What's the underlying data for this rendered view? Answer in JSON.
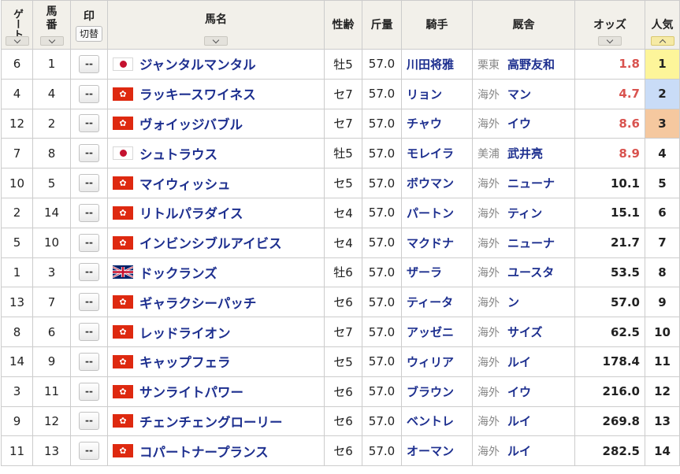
{
  "header": {
    "gate": "ゲート",
    "umaban": "馬番",
    "mark": "印",
    "mark_toggle": "切替",
    "name": "馬名",
    "sex_age": "性齢",
    "weight": "斤量",
    "jockey": "騎手",
    "trainer": "厩舎",
    "odds": "オッズ",
    "popularity": "人気"
  },
  "mark_placeholder": "--",
  "colors": {
    "horse_link": "#1d2f8f",
    "hot_odds": "#d9534f",
    "pop1": "#fdf59a",
    "pop2": "#c9dcf7",
    "pop3": "#f5c89f"
  },
  "rows": [
    {
      "gate": "6",
      "umaban": "1",
      "flag": "jp",
      "name": "ジャンタルマンタル",
      "sex_age": "牡5",
      "weight": "57.0",
      "jockey": "川田将雅",
      "area": "栗東",
      "trainer": "高野友和",
      "odds": "1.8",
      "pop": "1"
    },
    {
      "gate": "4",
      "umaban": "4",
      "flag": "hk",
      "name": "ラッキースワイネス",
      "sex_age": "セ7",
      "weight": "57.0",
      "jockey": "リョン",
      "area": "海外",
      "trainer": "マン",
      "odds": "4.7",
      "pop": "2"
    },
    {
      "gate": "12",
      "umaban": "2",
      "flag": "hk",
      "name": "ヴォイッジバブル",
      "sex_age": "セ7",
      "weight": "57.0",
      "jockey": "チャウ",
      "area": "海外",
      "trainer": "イウ",
      "odds": "8.6",
      "pop": "3"
    },
    {
      "gate": "7",
      "umaban": "8",
      "flag": "jp",
      "name": "シュトラウス",
      "sex_age": "牡5",
      "weight": "57.0",
      "jockey": "モレイラ",
      "area": "美浦",
      "trainer": "武井亮",
      "odds": "8.9",
      "pop": "4"
    },
    {
      "gate": "10",
      "umaban": "5",
      "flag": "hk",
      "name": "マイウィッシュ",
      "sex_age": "セ5",
      "weight": "57.0",
      "jockey": "ボウマン",
      "area": "海外",
      "trainer": "ニューナ",
      "odds": "10.1",
      "pop": "5"
    },
    {
      "gate": "2",
      "umaban": "14",
      "flag": "hk",
      "name": "リトルパラダイス",
      "sex_age": "セ4",
      "weight": "57.0",
      "jockey": "パートン",
      "area": "海外",
      "trainer": "ティン",
      "odds": "15.1",
      "pop": "6"
    },
    {
      "gate": "5",
      "umaban": "10",
      "flag": "hk",
      "name": "インビンシブルアイビス",
      "sex_age": "セ4",
      "weight": "57.0",
      "jockey": "マクドナ",
      "area": "海外",
      "trainer": "ニューナ",
      "odds": "21.7",
      "pop": "7"
    },
    {
      "gate": "1",
      "umaban": "3",
      "flag": "gb",
      "name": "ドックランズ",
      "sex_age": "牡6",
      "weight": "57.0",
      "jockey": "ザーラ",
      "area": "海外",
      "trainer": "ユースタ",
      "odds": "53.5",
      "pop": "8"
    },
    {
      "gate": "13",
      "umaban": "7",
      "flag": "hk",
      "name": "ギャラクシーパッチ",
      "sex_age": "セ6",
      "weight": "57.0",
      "jockey": "ティータ",
      "area": "海外",
      "trainer": "ン",
      "odds": "57.0",
      "pop": "9"
    },
    {
      "gate": "8",
      "umaban": "6",
      "flag": "hk",
      "name": "レッドライオン",
      "sex_age": "セ7",
      "weight": "57.0",
      "jockey": "アッゼニ",
      "area": "海外",
      "trainer": "サイズ",
      "odds": "62.5",
      "pop": "10"
    },
    {
      "gate": "14",
      "umaban": "9",
      "flag": "hk",
      "name": "キャップフェラ",
      "sex_age": "セ5",
      "weight": "57.0",
      "jockey": "ウィリア",
      "area": "海外",
      "trainer": "ルイ",
      "odds": "178.4",
      "pop": "11"
    },
    {
      "gate": "3",
      "umaban": "11",
      "flag": "hk",
      "name": "サンライトパワー",
      "sex_age": "セ6",
      "weight": "57.0",
      "jockey": "ブラウン",
      "area": "海外",
      "trainer": "イウ",
      "odds": "216.0",
      "pop": "12"
    },
    {
      "gate": "9",
      "umaban": "12",
      "flag": "hk",
      "name": "チェンチェングローリー",
      "sex_age": "セ6",
      "weight": "57.0",
      "jockey": "ベントレ",
      "area": "海外",
      "trainer": "ルイ",
      "odds": "269.8",
      "pop": "13"
    },
    {
      "gate": "11",
      "umaban": "13",
      "flag": "hk",
      "name": "コパートナープランス",
      "sex_age": "セ6",
      "weight": "57.0",
      "jockey": "オーマン",
      "area": "海外",
      "trainer": "ルイ",
      "odds": "282.5",
      "pop": "14"
    }
  ]
}
